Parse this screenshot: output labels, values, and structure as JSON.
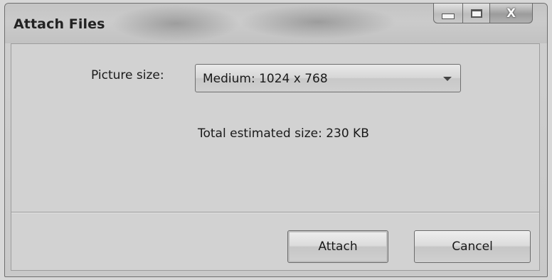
{
  "window": {
    "title": "Attach Files",
    "caption_buttons": {
      "minimize_icon": "minimize-icon",
      "maximize_icon": "maximize-icon",
      "close_glyph": "X"
    }
  },
  "form": {
    "picture_size_label": "Picture size:",
    "picture_size_selected": "Medium: 1024 x 768",
    "dropdown_icon": "chevron-down-icon",
    "estimate_text": "Total estimated size: 230 KB"
  },
  "buttons": {
    "attach_label": "Attach",
    "cancel_label": "Cancel"
  }
}
